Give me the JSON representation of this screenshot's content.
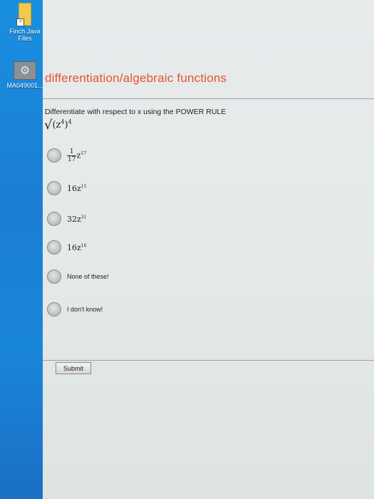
{
  "desktop": {
    "icons": [
      {
        "label_line1": "Finch Java",
        "label_line2": "Files",
        "icon": "folder-icon"
      },
      {
        "label_line1": "MA049001...",
        "icon": "gear-icon"
      }
    ]
  },
  "page": {
    "title": "differentiation/algebraic functions",
    "question": "Differentiate with respect to x using the POWER RULE",
    "prompt_math": {
      "base": "(z",
      "inner_exp": "4",
      "close": ")",
      "outer_exp": "4"
    },
    "options": [
      {
        "coef": "",
        "frac_num": "1",
        "frac_den": "17",
        "var": "z",
        "exp": "17"
      },
      {
        "coef": "16",
        "var": "z",
        "exp": "15"
      },
      {
        "coef": "32",
        "var": "z",
        "exp": "31"
      },
      {
        "coef": "16",
        "var": "z",
        "exp": "16"
      },
      {
        "text": "None of these!"
      },
      {
        "text": "I don't know!"
      }
    ],
    "submit_label": "Submit"
  },
  "colors": {
    "title": "#e8542b",
    "desktop": "#1a86d8"
  }
}
